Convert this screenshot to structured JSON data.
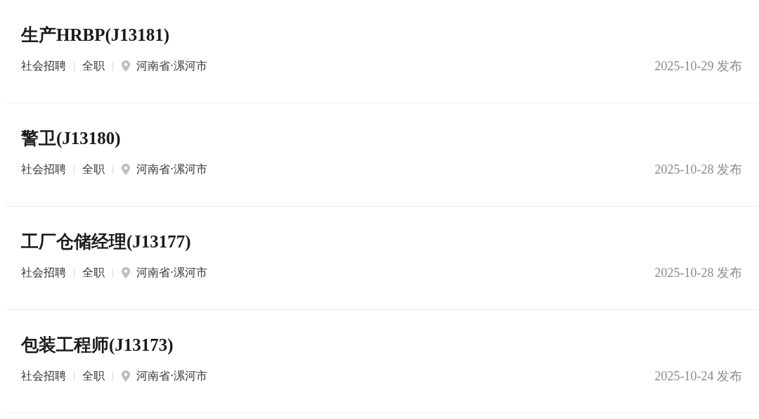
{
  "jobs": [
    {
      "title": "生产HRBP(J13181)",
      "type": "社会招聘",
      "schedule": "全职",
      "location": "河南省·漯河市",
      "date": "2025-10-29 发布"
    },
    {
      "title": "警卫(J13180)",
      "type": "社会招聘",
      "schedule": "全职",
      "location": "河南省·漯河市",
      "date": "2025-10-28 发布"
    },
    {
      "title": "工厂仓储经理(J13177)",
      "type": "社会招聘",
      "schedule": "全职",
      "location": "河南省·漯河市",
      "date": "2025-10-28 发布"
    },
    {
      "title": "包装工程师(J13173)",
      "type": "社会招聘",
      "schedule": "全职",
      "location": "河南省·漯河市",
      "date": "2025-10-24 发布"
    }
  ]
}
